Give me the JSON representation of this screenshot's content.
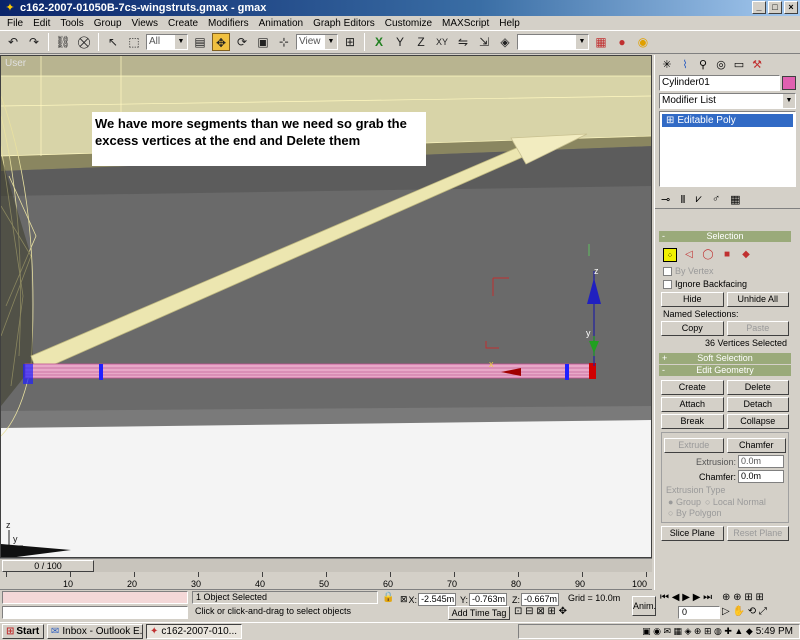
{
  "window": {
    "title": "c162-2007-01050B-7cs-wingstruts.gmax - gmax"
  },
  "menu": [
    "File",
    "Edit",
    "Tools",
    "Group",
    "Views",
    "Create",
    "Modifiers",
    "Animation",
    "Graph Editors",
    "Customize",
    "MAXScript",
    "Help"
  ],
  "toolbar": {
    "filter_value": "All",
    "refcoord_value": "View",
    "named_sel_value": ""
  },
  "viewport": {
    "label": "User",
    "tip_text": "We have more segments than we need so grab the excess vertices at the end and Delete them",
    "gizmo_labels": {
      "z": "z",
      "y": "y",
      "x": "x"
    }
  },
  "command_panel": {
    "object_name": "Cylinder01",
    "object_color": "#e060b0",
    "modifier_list": "Modifier List",
    "stack_items": [
      "Editable Poly"
    ],
    "selection": {
      "title": "Selection",
      "by_vertex": "By Vertex",
      "ignore_backfacing": "Ignore Backfacing",
      "hide": "Hide",
      "unhide_all": "Unhide All",
      "named_selections": "Named Selections:",
      "copy": "Copy",
      "paste": "Paste",
      "status": "36 Vertices Selected"
    },
    "soft_selection": {
      "title": "Soft Selection"
    },
    "edit_geometry": {
      "title": "Edit Geometry",
      "create": "Create",
      "delete": "Delete",
      "attach": "Attach",
      "detach": "Detach",
      "break": "Break",
      "collapse": "Collapse",
      "extrude": "Extrude",
      "chamfer": "Chamfer",
      "extrusion_label": "Extrusion:",
      "extrusion_value": "0.0m",
      "chamfer_label": "Chamfer:",
      "chamfer_value": "0.0m",
      "extrusion_type": "Extrusion Type",
      "group": "Group",
      "local_normal": "Local Normal",
      "by_polygon": "By Polygon",
      "slice_plane": "Slice Plane",
      "reset_plane": "Reset Plane"
    }
  },
  "timeline": {
    "frame_display": "0 / 100",
    "ticks": [
      "10",
      "20",
      "30",
      "40",
      "50",
      "60",
      "70",
      "80",
      "90",
      "100"
    ]
  },
  "status": {
    "selection": "1 Object Selected",
    "prompt": "Click or click-and-drag to select objects",
    "add_time_tag": "Add Time Tag",
    "x_label": "X:",
    "x_value": "-2.545m",
    "y_label": "Y:",
    "y_value": "-0.763m",
    "z_label": "Z:",
    "z_value": "-0.667m",
    "grid": "Grid = 10.0m",
    "anim": "Anim.",
    "frame": "0"
  },
  "taskbar": {
    "start": "Start",
    "tasks": [
      "Inbox - Outlook E...",
      "c162-2007-010..."
    ],
    "time": "5:49 PM"
  }
}
